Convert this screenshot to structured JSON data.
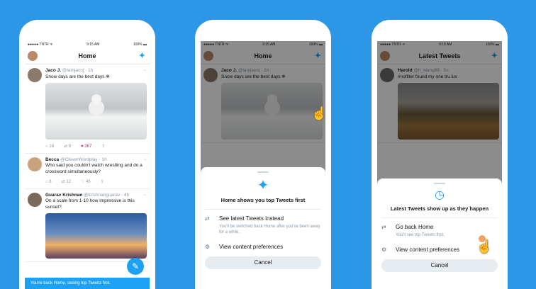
{
  "phone1": {
    "status": {
      "carrier": "●●●●● TNTR ᯤ",
      "time": "9:15 AM",
      "battery": "100% ▬"
    },
    "title": "Home",
    "tweets": [
      {
        "name": "Jaco J.",
        "handle": "@lamjacoj · 1h",
        "text": "Snow days are the best days ❄",
        "stats": {
          "reply": "16",
          "retweet": "5",
          "like": "367"
        }
      },
      {
        "name": "Becca",
        "handle": "@CleverWordplay · 1h",
        "text": "Who said you couldn't watch wrestling and do a crossword simultaneously?",
        "stats": {
          "reply": "8",
          "retweet": "12",
          "like": "45"
        }
      },
      {
        "name": "Guarav Krishnan",
        "handle": "@krishnanguarav · 4h",
        "text": "On a scale from 1-10 how impressive is this sunset?"
      }
    ],
    "toast": "You're back Home, seeing top Tweets first."
  },
  "phone2": {
    "status": {
      "carrier": "●●●●● TNTR ᯤ",
      "time": "9:15 AM",
      "battery": "100% ▬"
    },
    "title": "Home",
    "tweet": {
      "name": "Jaco J.",
      "handle": "@lamjacoj · 1h",
      "text": "Snow days are the best days ❄"
    },
    "sheet": {
      "title": "Home shows you top Tweets first",
      "option1": {
        "label": "See latest Tweets instead",
        "sub": "You'll be switched back Home after you've been away for a while."
      },
      "option2": {
        "label": "View content preferences"
      },
      "cancel": "Cancel"
    }
  },
  "phone3": {
    "status": {
      "carrier": "●●●●● TNTR ᯤ",
      "time": "9:15 AM",
      "battery": "100% ▬"
    },
    "title": "Latest Tweets",
    "tweet": {
      "name": "Harold",
      "handle": "@h_wang88 · 5s",
      "text": "#nofilter found my one tru luv"
    },
    "sheet": {
      "title": "Latest Tweets show up as they happen",
      "option1": {
        "label": "Go back Home",
        "sub": "You'll see top Tweets first."
      },
      "option2": {
        "label": "View content preferences"
      },
      "cancel": "Cancel"
    }
  }
}
